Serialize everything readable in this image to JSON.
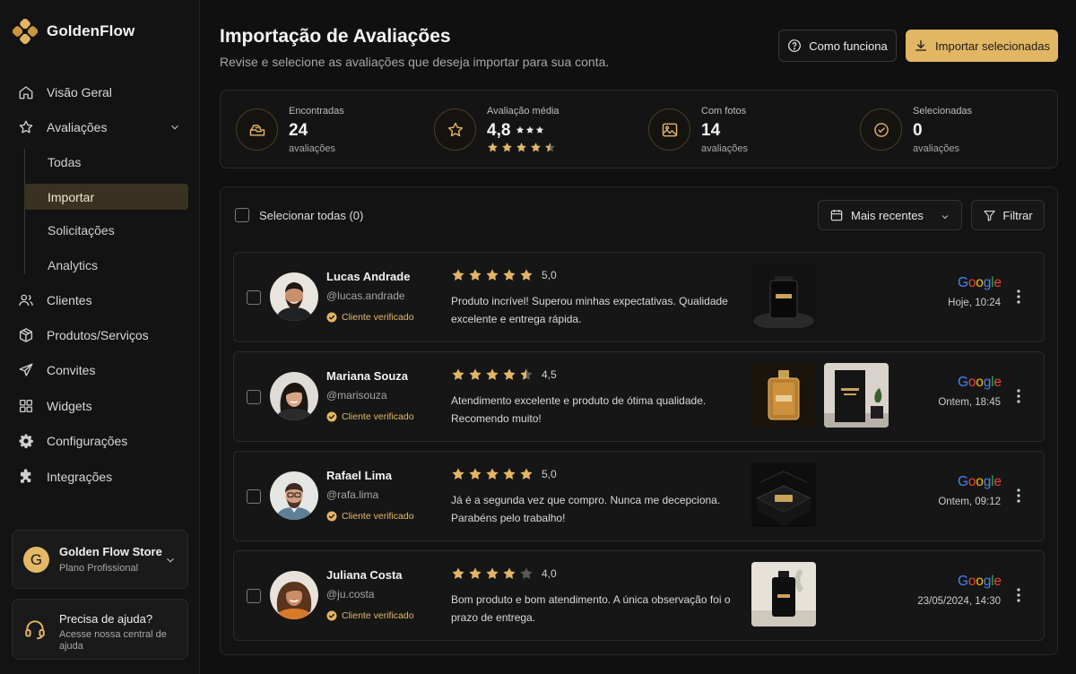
{
  "brand": {
    "name": "GoldenFlow"
  },
  "sidebar": {
    "items": [
      {
        "label": "Visão Geral",
        "icon": "home-icon"
      },
      {
        "label": "Avaliações",
        "icon": "star-icon"
      },
      {
        "label": "Clientes",
        "icon": "users-icon"
      },
      {
        "label": "Produtos/Serviços",
        "icon": "box-icon"
      },
      {
        "label": "Convites",
        "icon": "send-icon"
      },
      {
        "label": "Widgets",
        "icon": "grid-icon"
      },
      {
        "label": "Configurações",
        "icon": "gear-icon"
      },
      {
        "label": "Integrações",
        "icon": "puzzle-icon"
      }
    ],
    "sub_items": [
      {
        "label": "Todas"
      },
      {
        "label": "Importar",
        "active": true
      },
      {
        "label": "Solicitações"
      },
      {
        "label": "Analytics"
      }
    ],
    "store": {
      "initial": "G",
      "name": "Golden Flow Store",
      "plan": "Plano Profissional"
    },
    "help": {
      "title": "Precisa de ajuda?",
      "description": "Acesse nossa central de ajuda"
    }
  },
  "header": {
    "title": "Importação de Avaliações",
    "subtitle": "Revise e selecione as avaliações que deseja importar para sua conta.",
    "how_label": "Como funciona",
    "import_label": "Importar selecionadas"
  },
  "stats": [
    {
      "label": "Encontradas",
      "value": "24",
      "unit": "avaliações"
    },
    {
      "label": "Avaliação média",
      "value": "4,8",
      "rating": 4.5
    },
    {
      "label": "Com fotos",
      "value": "14",
      "unit": "avaliações"
    },
    {
      "label": "Selecionadas",
      "value": "0",
      "unit": "avaliações"
    }
  ],
  "list": {
    "select_all_label": "Selecionar todas (0)",
    "sort_label": "Mais recentes",
    "filter_label": "Filtrar"
  },
  "reviews": [
    {
      "name": "Lucas Andrade",
      "handle": "@lucas.andrade",
      "verified": "Cliente verificado",
      "rating": 5,
      "score": "5,0",
      "text": "Produto incrível! Superou minhas expectativas. Qualidade excelente e entrega rápida.",
      "source": "Google",
      "date": "Hoje, 10:24"
    },
    {
      "name": "Mariana Souza",
      "handle": "@marisouza",
      "verified": "Cliente verificado",
      "rating": 4.5,
      "score": "4,5",
      "text": "Atendimento excelente e produto de ótima qualidade. Recomendo muito!",
      "source": "Google",
      "date": "Ontem, 18:45"
    },
    {
      "name": "Rafael Lima",
      "handle": "@rafa.lima",
      "verified": "Cliente verificado",
      "rating": 5,
      "score": "5,0",
      "text": "Já é a segunda vez que compro. Nunca me decepciona. Parabéns pelo trabalho!",
      "source": "Google",
      "date": "Ontem, 09:12"
    },
    {
      "name": "Juliana Costa",
      "handle": "@ju.costa",
      "verified": "Cliente verificado",
      "rating": 4,
      "score": "4,0",
      "text": "Bom produto e bom atendimento. A única observação foi o prazo de entrega.",
      "source": "Google",
      "date": "23/05/2024, 14:30"
    }
  ],
  "colors": {
    "accent": "#E3B664",
    "background": "#101010",
    "panel": "#141414",
    "active_nav": "#3A3220"
  }
}
